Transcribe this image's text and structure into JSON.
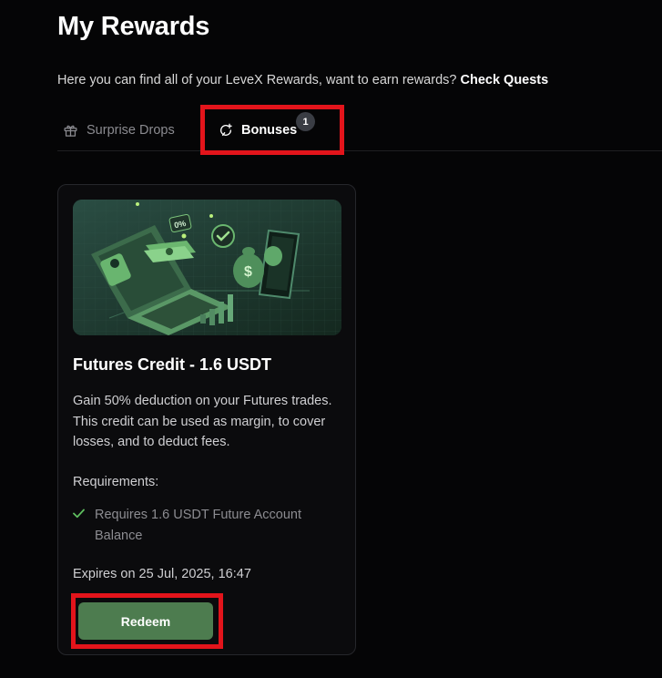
{
  "header": {
    "title": "My Rewards",
    "subtitle": "Here you can find all of your LeveX Rewards, want to earn rewards? ",
    "quests_link": "Check Quests"
  },
  "tabs": [
    {
      "label": "Surprise Drops",
      "icon": "gift-icon",
      "active": false
    },
    {
      "label": "Bonuses",
      "icon": "bonus-icon",
      "active": true,
      "badge": "1"
    }
  ],
  "reward_card": {
    "title": "Futures Credit - 1.6 USDT",
    "description": "Gain 50% deduction on your Futures trades. This credit can be used as margin, to cover losses, and to deduct fees.",
    "requirements_label": "Requirements:",
    "requirements": [
      "Requires 1.6 USDT Future Account Balance"
    ],
    "expires": "Expires on 25 Jul, 2025, 16:47",
    "redeem_label": "Redeem",
    "image_text": "0%",
    "colors": {
      "accent": "#4d7c4f",
      "check": "#5fbf5f"
    }
  },
  "annotations": {
    "highlight_color": "#e3141b"
  }
}
